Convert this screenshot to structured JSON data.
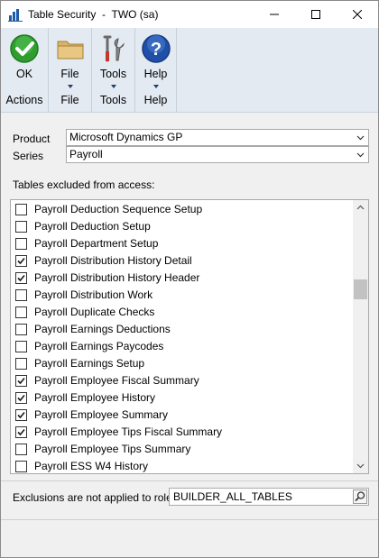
{
  "window": {
    "title": "Table Security  -  TWO (sa)",
    "controls": [
      "minimize-icon",
      "maximize-icon",
      "close-icon"
    ]
  },
  "ribbon": {
    "groups": [
      {
        "button_label": "OK",
        "group_label": "Actions",
        "icon": "ok-check-icon",
        "has_dropdown": false
      },
      {
        "button_label": "File",
        "group_label": "File",
        "icon": "folder-icon",
        "has_dropdown": true
      },
      {
        "button_label": "Tools",
        "group_label": "Tools",
        "icon": "tools-icon",
        "has_dropdown": true
      },
      {
        "button_label": "Help",
        "group_label": "Help",
        "icon": "help-icon",
        "has_dropdown": true
      }
    ]
  },
  "form": {
    "product_label": "Product",
    "product_value": "Microsoft Dynamics GP",
    "series_label": "Series",
    "series_value": "Payroll",
    "tables_label": "Tables excluded from access:",
    "tables": [
      {
        "label": "Payroll Deduction Sequence Setup",
        "checked": false
      },
      {
        "label": "Payroll Deduction Setup",
        "checked": false
      },
      {
        "label": "Payroll Department Setup",
        "checked": false
      },
      {
        "label": "Payroll Distribution History Detail",
        "checked": true
      },
      {
        "label": "Payroll Distribution History Header",
        "checked": true
      },
      {
        "label": "Payroll Distribution Work",
        "checked": false
      },
      {
        "label": "Payroll Duplicate Checks",
        "checked": false
      },
      {
        "label": "Payroll Earnings Deductions",
        "checked": false
      },
      {
        "label": "Payroll Earnings Paycodes",
        "checked": false
      },
      {
        "label": "Payroll Earnings Setup",
        "checked": false
      },
      {
        "label": "Payroll Employee Fiscal Summary",
        "checked": true
      },
      {
        "label": "Payroll Employee History",
        "checked": true
      },
      {
        "label": "Payroll Employee Summary",
        "checked": true
      },
      {
        "label": "Payroll Employee Tips Fiscal Summary",
        "checked": true
      },
      {
        "label": "Payroll Employee Tips Summary",
        "checked": false
      },
      {
        "label": "Payroll ESS W4 History",
        "checked": false
      }
    ],
    "role_label": "Exclusions are not applied to role",
    "role_value": "BUILDER_ALL_TABLES"
  },
  "colors": {
    "ribbon_bg": "#e4eaf2",
    "check_green": "#2f9e2f",
    "help_blue": "#1f4fa8",
    "checkmark": "#1a1a1a"
  }
}
